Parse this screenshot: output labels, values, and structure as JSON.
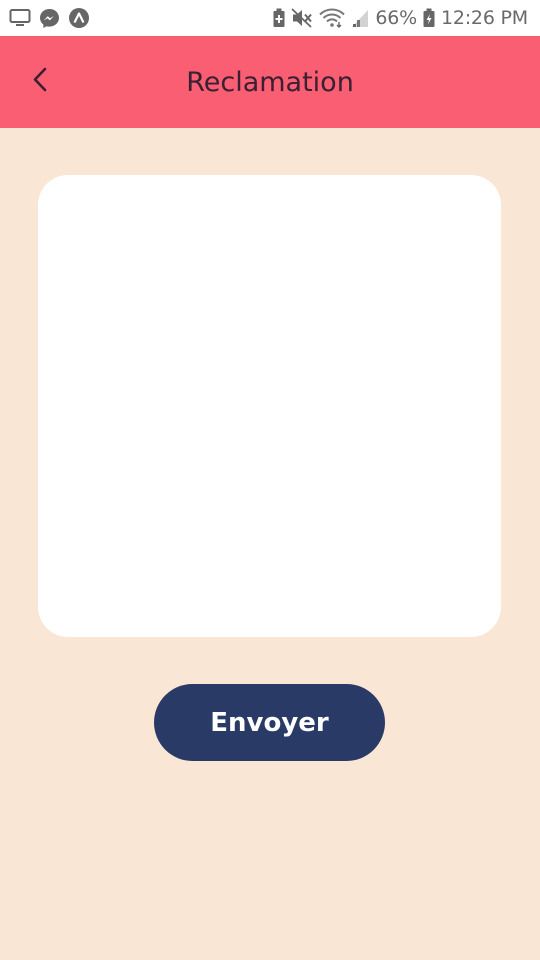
{
  "status_bar": {
    "battery_percent": "66%",
    "time": "12:26 PM",
    "left_icons": [
      "screen-cast-icon",
      "messenger-icon",
      "expo-icon"
    ],
    "right_icons": [
      "battery-saver-icon",
      "mute-icon",
      "wifi-icon",
      "signal-icon",
      "battery-icon"
    ]
  },
  "header": {
    "title": "Reclamation",
    "back_icon": "chevron-left-icon",
    "background_color": "#f95e73"
  },
  "form": {
    "message_value": "",
    "message_placeholder": "",
    "submit_label": "Envoyer",
    "submit_color": "#283a65"
  },
  "page": {
    "background_color": "#fae6d4"
  }
}
